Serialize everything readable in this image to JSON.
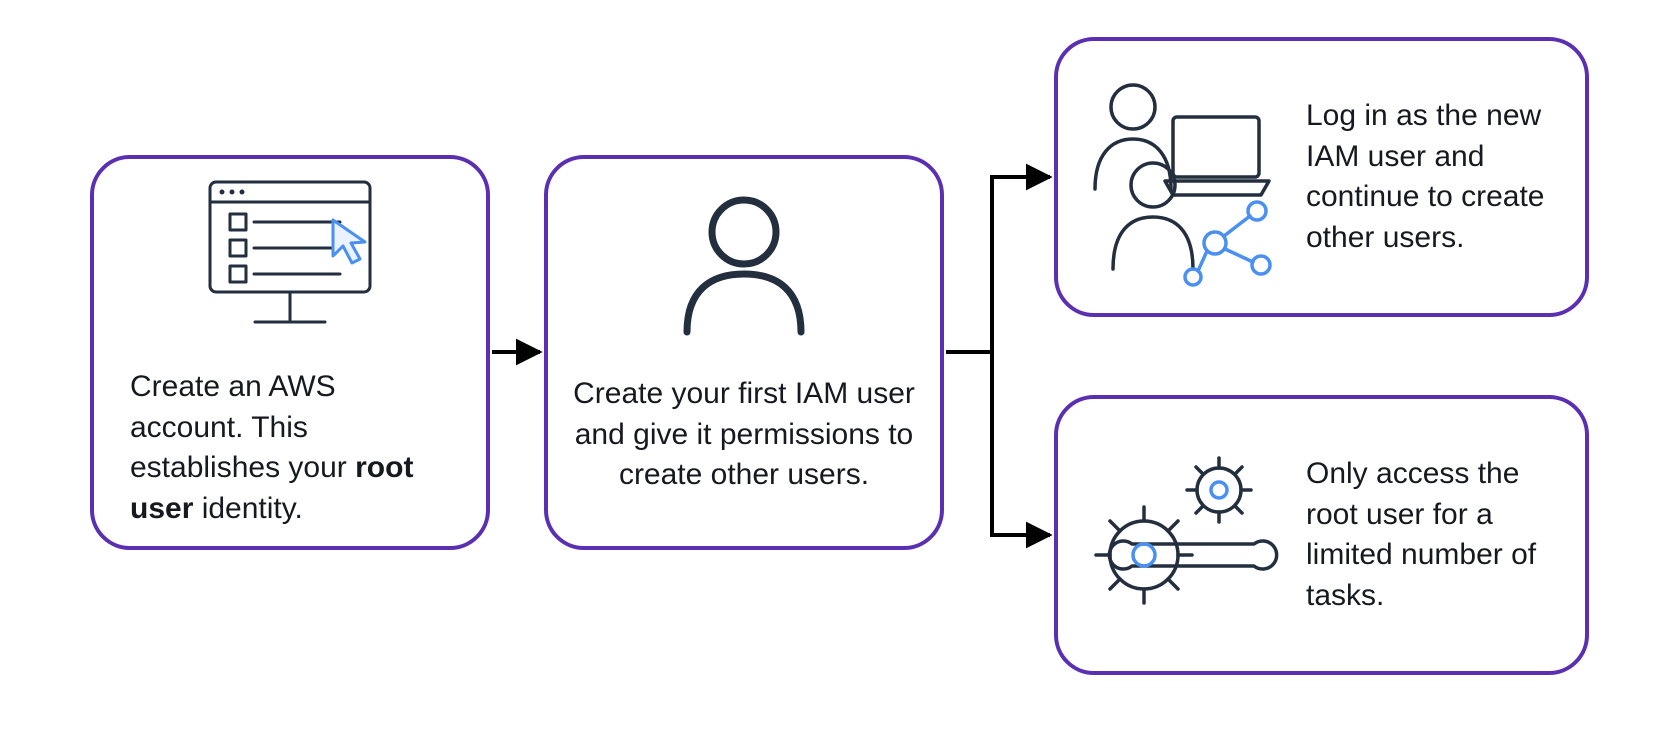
{
  "steps": {
    "create_account": {
      "text_pre": "Create an AWS account. This establishes your ",
      "text_bold": "root user",
      "text_post": " identity."
    },
    "create_user": {
      "text": "Create your first IAM user and give it permissions to create other users."
    },
    "login_new_user": {
      "text": "Log in as the new IAM user and continue to create other users."
    },
    "root_limited": {
      "text": "Only access the root user for a limited number of tasks."
    }
  },
  "icons": {
    "account": "monitor-checklist-cursor",
    "user": "person-outline",
    "users": "users-laptop-network",
    "settings": "gears-wrench"
  },
  "colors": {
    "border": "#5a2fb1",
    "stroke": "#232f3e",
    "accent": "#4a90f2"
  }
}
